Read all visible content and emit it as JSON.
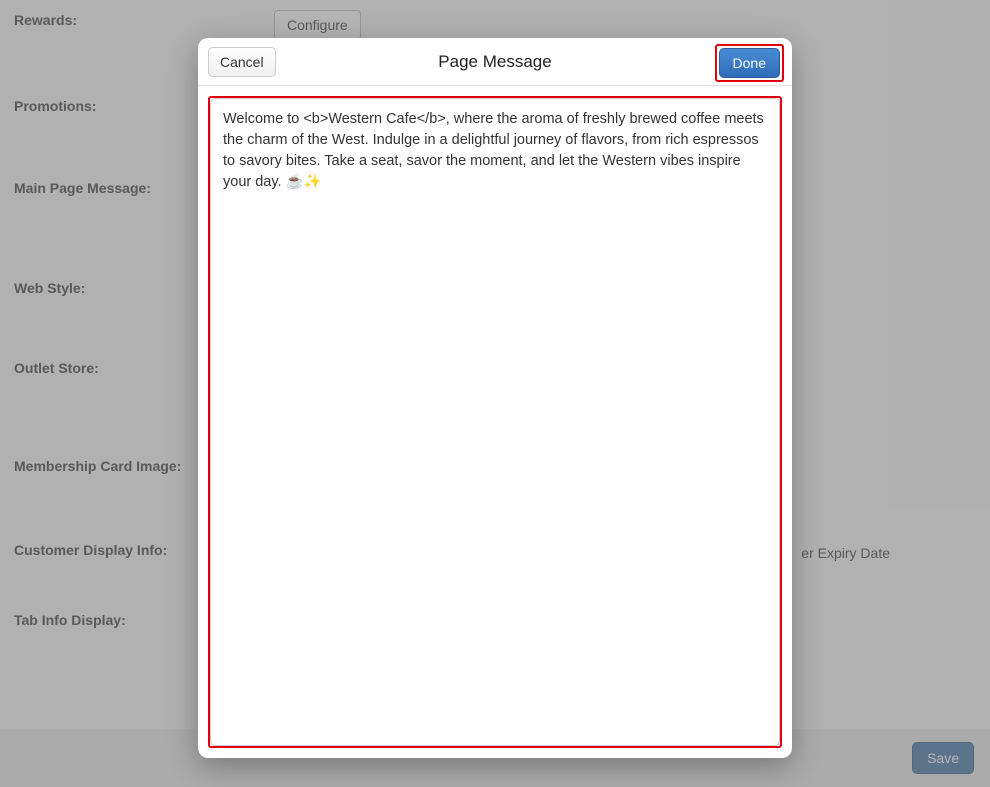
{
  "form": {
    "rewards_label": "Rewards:",
    "configure_label": "Configure",
    "promotions_label": "Promotions:",
    "main_page_message_label": "Main Page Message:",
    "web_style_label": "Web Style:",
    "outlet_store_label": "Outlet Store:",
    "membership_card_image_label": "Membership Card Image:",
    "customer_display_info_label": "Customer Display Info:",
    "customer_display_info_partial": "er Expiry Date",
    "tab_info_display_label": "Tab Info Display:",
    "save_label": "Save"
  },
  "modal": {
    "title": "Page Message",
    "cancel_label": "Cancel",
    "done_label": "Done",
    "message_value": "Welcome to <b>Western Cafe</b>, where the aroma of freshly brewed coffee meets the charm of the West. Indulge in a delightful journey of flavors, from rich espressos to savory bites. Take a seat, savor the moment, and let the Western vibes inspire your day. ☕✨"
  }
}
